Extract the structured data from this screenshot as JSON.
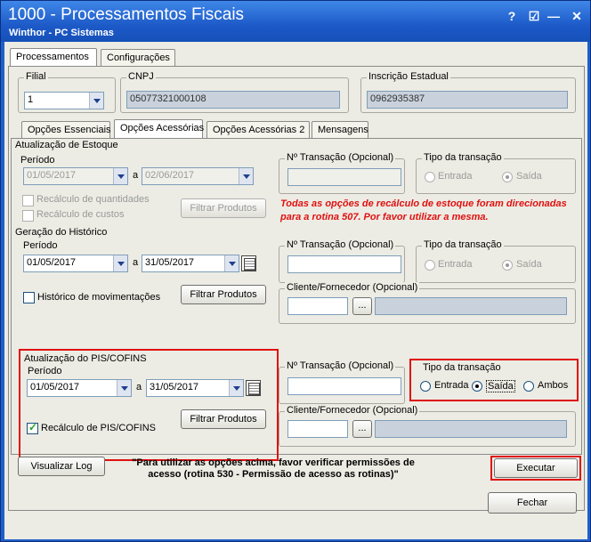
{
  "window": {
    "title": "1000 - Processamentos Fiscais",
    "subtitle": "Winthor - PC Sistemas",
    "help": "?",
    "controls": [
      "☑",
      "—",
      "☐",
      "✕"
    ]
  },
  "top_tabs": [
    "Processamentos",
    "Configurações"
  ],
  "filial": {
    "label": "Filial",
    "value": "1"
  },
  "cnpj": {
    "label": "CNPJ",
    "value": "05077321000108"
  },
  "ie": {
    "label": "Inscrição Estadual",
    "value": "0962935387"
  },
  "sub_tabs": [
    "Opções Essenciais",
    "Opções Acessórias",
    "Opções Acessórias 2",
    "Mensagens"
  ],
  "estoque": {
    "title": "Atualização de Estoque",
    "periodo": "Período",
    "de": "01/05/2017",
    "ate": "02/06/2017",
    "a": "a",
    "rec_qtd": "Recálculo de quantidades",
    "rec_custos": "Recálculo de custos",
    "filtrar": "Filtrar Produtos",
    "ntrans": "Nº Transação (Opcional)",
    "tipo": "Tipo da transação",
    "entrada": "Entrada",
    "saida": "Saída",
    "msg": "Todas as opções de recálculo de estoque foram direcionadas para a rotina 507. Por favor utilizar a mesma."
  },
  "historico": {
    "title": "Geração do Histórico",
    "periodo": "Período",
    "de": "01/05/2017",
    "ate": "31/05/2017",
    "a": "a",
    "hist_mov": "Histórico de movimentações",
    "filtrar": "Filtrar Produtos",
    "ntrans": "Nº Transação (Opcional)",
    "tipo": "Tipo da transação",
    "entrada": "Entrada",
    "saida": "Saída",
    "cliente": "Cliente/Fornecedor (Opcional)",
    "dots": "..."
  },
  "pis": {
    "title": "Atualização do PIS/COFINS",
    "periodo": "Período",
    "de": "01/05/2017",
    "ate": "31/05/2017",
    "a": "a",
    "recalc": "Recálculo de PIS/COFINS",
    "filtrar": "Filtrar Produtos",
    "ntrans": "Nº Transação (Opcional)",
    "tipo": "Tipo da transação",
    "entrada": "Entrada",
    "saida": "Saída",
    "ambos": "Ambos",
    "cliente": "Cliente/Fornecedor (Opcional)",
    "dots": "..."
  },
  "footer": {
    "visualizar": "Visualizar Log",
    "note": "\"Para utilizar as opções acima, favor verificar permissões de acesso (rotina 530 - Permissão de acesso as rotinas)\"",
    "executar": "Executar",
    "fechar": "Fechar"
  }
}
